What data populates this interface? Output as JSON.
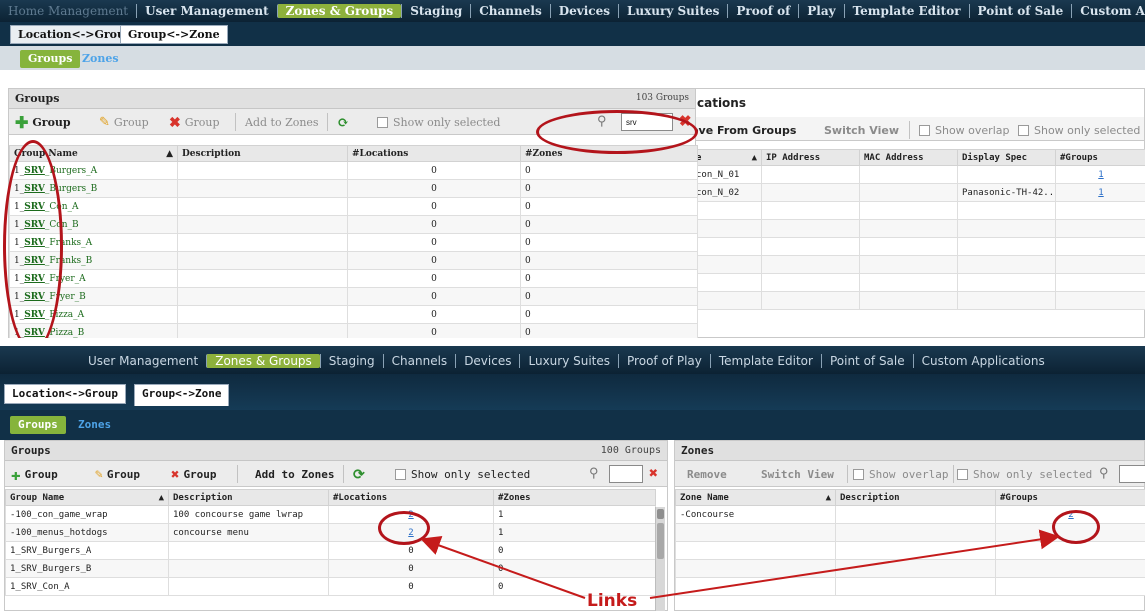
{
  "top_screenshot": {
    "nav_items": [
      "User Management",
      "Zones & Groups",
      "Staging",
      "Channels",
      "Devices",
      "Luxury Suites",
      "Proof of",
      "Play",
      "Template Editor",
      "Point of Sale",
      "Custom Applications"
    ],
    "nav_prefix": "Home Management",
    "tabs": [
      "Location<->Group",
      "Group<->Zone"
    ],
    "subtabs": [
      "Groups",
      "Zones"
    ],
    "groups_panel": {
      "title": "Groups",
      "count": "103 Groups",
      "toolbar": {
        "add": "Group",
        "edit": "Group",
        "delete": "Group",
        "add_to_zones": "Add to Zones",
        "show_only_selected": "Show only selected"
      },
      "search_value": "srv",
      "columns": [
        "Group Name",
        "Description",
        "#Locations",
        "#Zones"
      ],
      "rows": [
        {
          "prefix": "1_",
          "srv": "SRV",
          "rest": "_Burgers_A",
          "desc": "",
          "locations": "0",
          "zones": "0"
        },
        {
          "prefix": "1_",
          "srv": "SRV",
          "rest": "_Burgers_B",
          "desc": "",
          "locations": "0",
          "zones": "0"
        },
        {
          "prefix": "1_",
          "srv": "SRV",
          "rest": "_Con_A",
          "desc": "",
          "locations": "0",
          "zones": "0"
        },
        {
          "prefix": "1_",
          "srv": "SRV",
          "rest": "_Con_B",
          "desc": "",
          "locations": "0",
          "zones": "0"
        },
        {
          "prefix": "1_",
          "srv": "SRV",
          "rest": "_Franks_A",
          "desc": "",
          "locations": "0",
          "zones": "0"
        },
        {
          "prefix": "1_",
          "srv": "SRV",
          "rest": "_Franks_B",
          "desc": "",
          "locations": "0",
          "zones": "0"
        },
        {
          "prefix": "1_",
          "srv": "SRV",
          "rest": "_Fryer_A",
          "desc": "",
          "locations": "0",
          "zones": "0"
        },
        {
          "prefix": "1_",
          "srv": "SRV",
          "rest": "_Fryer_B",
          "desc": "",
          "locations": "0",
          "zones": "0"
        },
        {
          "prefix": "1_",
          "srv": "SRV",
          "rest": "_Pizza_A",
          "desc": "",
          "locations": "0",
          "zones": "0"
        },
        {
          "prefix": "1_",
          "srv": "SRV",
          "rest": "_Pizza_B",
          "desc": "",
          "locations": "0",
          "zones": "0"
        }
      ]
    },
    "locations_panel": {
      "title_fragment": "cations",
      "toolbar": {
        "remove": "ove From Groups",
        "switch_view": "Switch View",
        "show_overlap": "Show overlap",
        "show_only_selected": "Show only selected"
      },
      "columns": [
        "e",
        "IP Address",
        "MAC Address",
        "Display Spec",
        "#Groups"
      ],
      "rows": [
        {
          "name": "con_N_01",
          "ip": "",
          "mac": "",
          "spec": "",
          "groups": "1"
        },
        {
          "name": "con_N_02",
          "ip": "",
          "mac": "",
          "spec": "Panasonic-TH-42...",
          "groups": "1"
        }
      ]
    }
  },
  "bottom_screenshot": {
    "nav_items": [
      "User Management",
      "Zones & Groups",
      "Staging",
      "Channels",
      "Devices",
      "Luxury Suites",
      "Proof of Play",
      "Template Editor",
      "Point of Sale",
      "Custom Applications"
    ],
    "tabs": [
      "Location<->Group",
      "Group<->Zone"
    ],
    "subtabs": [
      "Groups",
      "Zones"
    ],
    "groups_panel": {
      "title": "Groups",
      "count": "100 Groups",
      "toolbar": {
        "add": "Group",
        "edit": "Group",
        "delete": "Group",
        "add_to_zones": "Add to Zones",
        "show_only_selected": "Show only selected"
      },
      "columns": [
        "Group Name",
        "Description",
        "#Locations",
        "#Zones"
      ],
      "rows": [
        {
          "name": "-100_con_game_wrap",
          "desc": "100 concourse game lwrap",
          "locations": "2",
          "zones": "1",
          "loc_link": true
        },
        {
          "name": "-100_menus_hotdogs",
          "desc": "concourse menu",
          "locations": "2",
          "zones": "1",
          "loc_link": true
        },
        {
          "name": "1_SRV_Burgers_A",
          "desc": "",
          "locations": "0",
          "zones": "0",
          "loc_link": false
        },
        {
          "name": "1_SRV_Burgers_B",
          "desc": "",
          "locations": "0",
          "zones": "0",
          "loc_link": false
        },
        {
          "name": "1_SRV_Con_A",
          "desc": "",
          "locations": "0",
          "zones": "0",
          "loc_link": false
        }
      ]
    },
    "zones_panel": {
      "title": "Zones",
      "toolbar": {
        "remove": "Remove",
        "switch_view": "Switch View",
        "show_overlap": "Show overlap",
        "show_only_selected": "Show only selected"
      },
      "columns": [
        "Zone Name",
        "Description",
        "#Groups"
      ],
      "rows": [
        {
          "name": "-Concourse",
          "desc": "",
          "groups": "2"
        }
      ]
    },
    "callout_label": "Links"
  }
}
